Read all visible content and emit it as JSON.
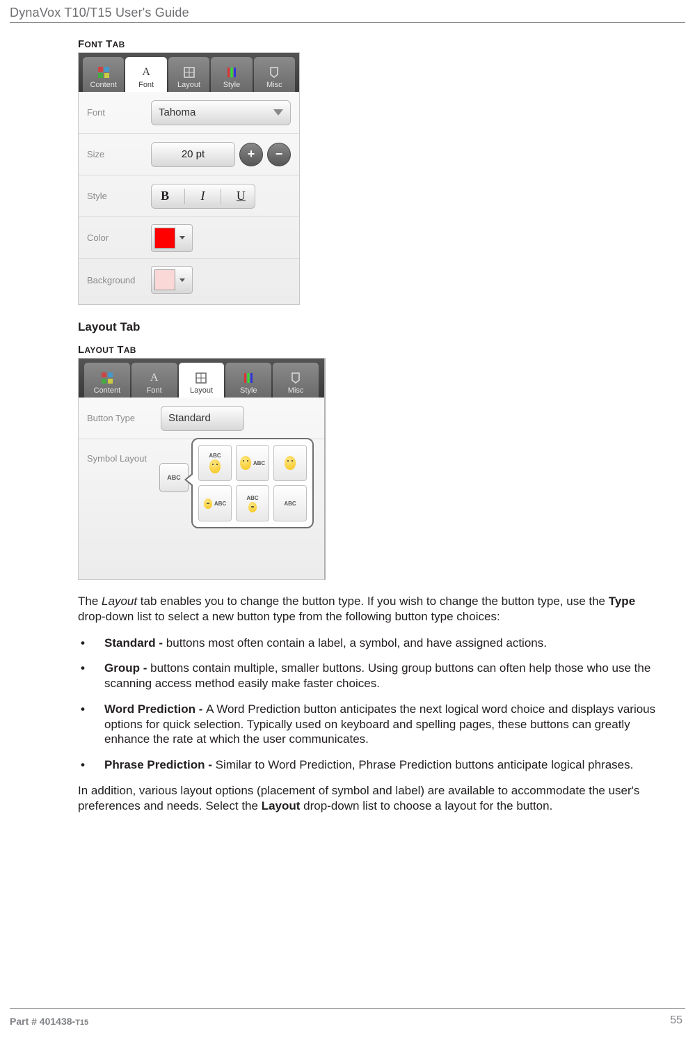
{
  "header": {
    "title": "DynaVox T10/T15 User's Guide"
  },
  "section1": {
    "caption": "FONT TAB",
    "tabs": [
      "Content",
      "Font",
      "Layout",
      "Style",
      "Misc"
    ],
    "activeTab": 1,
    "rows": {
      "font": {
        "label": "Font",
        "value": "Tahoma"
      },
      "size": {
        "label": "Size",
        "value": "20 pt"
      },
      "style": {
        "label": "Style",
        "bold": "B",
        "italic": "I",
        "underline": "U"
      },
      "color": {
        "label": "Color",
        "swatch": "#ff0000"
      },
      "bg": {
        "label": "Background",
        "swatch": "#fbd8d8"
      }
    }
  },
  "section2": {
    "heading": "Layout Tab",
    "caption": "LAYOUT TAB",
    "tabs": [
      "Content",
      "Font",
      "Layout",
      "Style",
      "Misc"
    ],
    "activeTab": 2,
    "buttonTypeLabel": "Button Type",
    "buttonTypeValue": "Standard",
    "symbolLayoutLabel": "Symbol Layout",
    "symbolBtn": "ABC",
    "cells": [
      "ABC",
      "ABC",
      "",
      "ABC",
      "ABC",
      "ABC"
    ]
  },
  "body": {
    "p1a": "The ",
    "p1b": "Layout",
    "p1c": " tab enables you to change the button type. If you wish to change the button type, use the ",
    "p1d": "Type",
    "p1e": " drop-down list to select a new button type from the following button type choices:",
    "bullets": [
      {
        "lead": "Standard - ",
        "text": "buttons most often contain a label, a symbol, and have assigned actions."
      },
      {
        "lead": "Group - ",
        "text": "buttons contain multiple, smaller buttons. Using group buttons can often help those who use the scanning access method easily make faster choices."
      },
      {
        "lead": "Word Prediction - ",
        "text": "A Word Prediction button anticipates the next logical word choice and displays various options for quick selection. Typically used on keyboard and spelling pages, these buttons can greatly enhance the rate at which the user communicates."
      },
      {
        "lead": "Phrase Prediction - ",
        "text": "Similar to Word Prediction, Phrase Prediction buttons anticipate logical phrases."
      }
    ],
    "p2a": "In addition, various layout options (placement of symbol and label) are available to accommodate the user's preferences and needs. Select the ",
    "p2b": "Layout",
    "p2c": " drop-down list to choose a layout for the button."
  },
  "footer": {
    "left": "Part # 401438-",
    "suffix": "T15",
    "page": "55"
  }
}
